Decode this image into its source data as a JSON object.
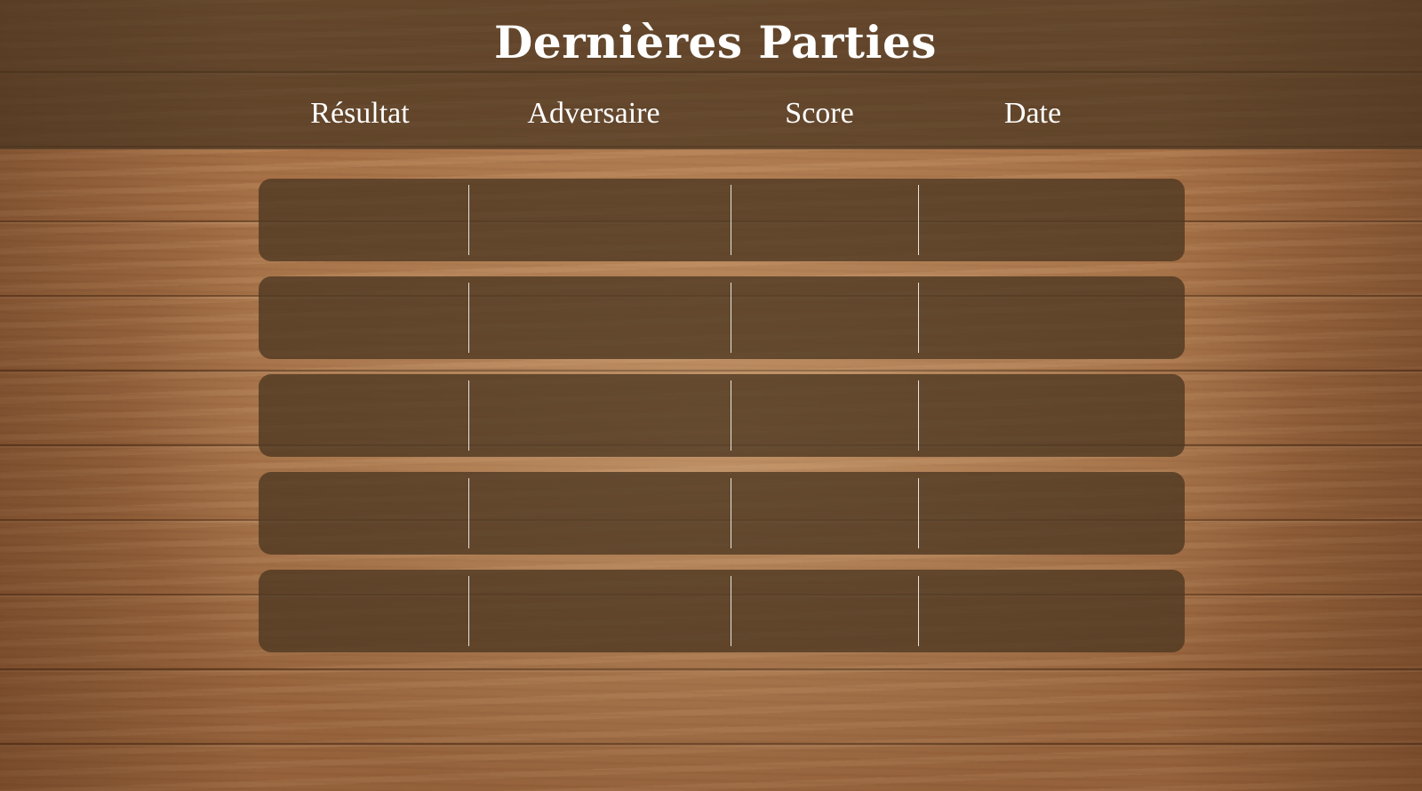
{
  "screen": {
    "title": "Dernières Parties"
  },
  "table": {
    "headers": {
      "result": "Résultat",
      "opponent": "Adversaire",
      "score": "Score",
      "date": "Date"
    },
    "rows": [
      {
        "result": "",
        "opponent": "",
        "score": "",
        "date": ""
      },
      {
        "result": "",
        "opponent": "",
        "score": "",
        "date": ""
      },
      {
        "result": "",
        "opponent": "",
        "score": "",
        "date": ""
      },
      {
        "result": "",
        "opponent": "",
        "score": "",
        "date": ""
      },
      {
        "result": "",
        "opponent": "",
        "score": "",
        "date": ""
      }
    ]
  },
  "colors": {
    "panel": "#4e3822",
    "header_band": "#483420",
    "text": "#ffffff",
    "wood": "#b07a4e"
  }
}
